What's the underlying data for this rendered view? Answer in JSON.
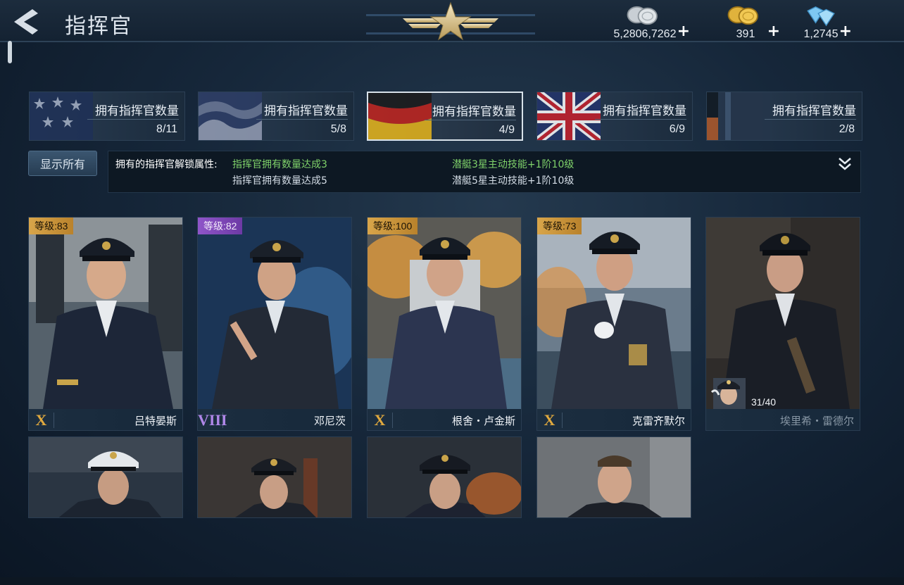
{
  "header": {
    "title": "指挥官",
    "currencies": [
      {
        "icon": "silver-coins-icon",
        "value": "5,2806,7262",
        "plus": "+"
      },
      {
        "icon": "gold-coins-icon",
        "value": "391",
        "plus": "+"
      },
      {
        "icon": "diamonds-icon",
        "value": "1,2745",
        "plus": "+"
      }
    ]
  },
  "nations": [
    {
      "flag": "usa-flag",
      "label": "拥有指挥官数量",
      "count": "8/11",
      "active": false
    },
    {
      "flag": "japan-flag",
      "label": "拥有指挥官数量",
      "count": "5/8",
      "active": false
    },
    {
      "flag": "germany-flag",
      "label": "拥有指挥官数量",
      "count": "4/9",
      "active": true
    },
    {
      "flag": "uk-flag",
      "label": "拥有指挥官数量",
      "count": "6/9",
      "active": false
    },
    {
      "flag": "soviet-flag",
      "label": "拥有指挥官数量",
      "count": "2/8",
      "active": false
    }
  ],
  "show_all_label": "显示所有",
  "unlock_info": {
    "heading": "拥有的指挥官解锁属性:",
    "rows": [
      {
        "condition": "指挥官拥有数量达成3",
        "bonus": "潜艇3星主动技能+1阶10级",
        "achieved": true
      },
      {
        "condition": "指挥官拥有数量达成5",
        "bonus": "潜艇5星主动技能+1阶10级",
        "achieved": false
      }
    ]
  },
  "commanders": [
    {
      "level": "等级:83",
      "rank": "X",
      "name": "吕特晏斯",
      "badge_color": "gold",
      "owned": true
    },
    {
      "level": "等级:82",
      "rank": "VIII",
      "name": "邓尼茨",
      "badge_color": "purple",
      "owned": true
    },
    {
      "level": "等级:100",
      "rank": "X",
      "name": "根舍・卢金斯",
      "badge_color": "gold",
      "owned": true
    },
    {
      "level": "等级:73",
      "rank": "X",
      "name": "克雷齐默尔",
      "badge_color": "gold",
      "owned": true
    },
    {
      "level": "",
      "rank": "",
      "name": "埃里希・雷德尔",
      "badge_color": "none",
      "owned": false,
      "fragments": "31/40"
    }
  ],
  "colors": {
    "accent_gold": "#d8a54a",
    "accent_purple": "#8f55c9",
    "unlocked_green": "#7fd26a",
    "background": "#16273a"
  }
}
